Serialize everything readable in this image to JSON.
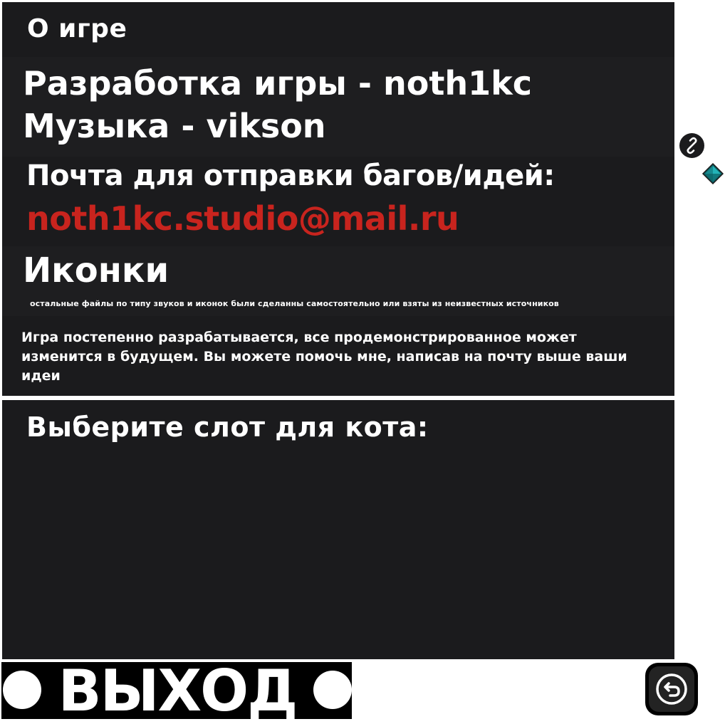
{
  "about": {
    "title": "О игре",
    "credits": {
      "dev": "Разработка игры - noth1kc",
      "music": "Музыка - vikson"
    },
    "bug_label": "Почта для отправки багов/идей:",
    "email": "noth1kc.studio@mail.ru",
    "icons_title": "Иконки",
    "icons_note": "остальные файлы по типу звуков и иконок были сделанны самостоятельно или взяты из неизвестных источников",
    "dev_note": "Игра постепенно разрабатывается, все продемонстрированное может изменится в будущем. Вы можете помочь мне, написав на почту выше ваши идеи"
  },
  "slots": {
    "title": "Выберите слот для кота:"
  },
  "exit": {
    "label": "ВЫХОД"
  },
  "icons": {
    "back": "undo-arrow-icon",
    "link": "link-chain-icon",
    "gem": "teal-gem-icon"
  },
  "colors": {
    "panel": "#1b1b1d",
    "accent_email": "#c8241e",
    "text": "#ffffff",
    "gem": "#1f9aa0"
  }
}
